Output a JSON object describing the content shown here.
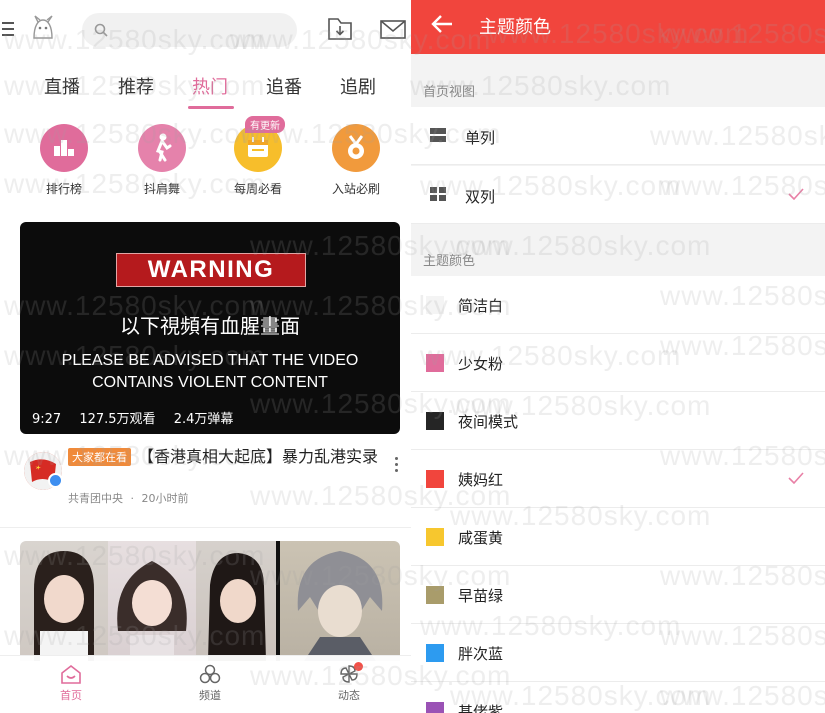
{
  "left": {
    "tabs": [
      "直播",
      "推荐",
      "热门",
      "追番",
      "追剧"
    ],
    "active_tab": "热门",
    "quick": [
      {
        "label": "排行榜",
        "color": "#e06c9b",
        "icon": "podium-icon"
      },
      {
        "label": "抖肩舞",
        "color": "#e582ab",
        "icon": "dancer-icon"
      },
      {
        "label": "每周必看",
        "color": "#f7be2b",
        "icon": "calendar-icon",
        "badge": "有更新"
      },
      {
        "label": "入站必刷",
        "color": "#f19a3c",
        "icon": "medal-icon"
      }
    ],
    "video": {
      "warning": "WARNING",
      "cn": "以下視頻有血腥畫面",
      "en1": "PLEASE BE ADVISED THAT THE VIDEO",
      "en2": "CONTAINS VIOLENT CONTENT",
      "duration": "9:27",
      "views": "127.5万观看",
      "danmaku": "2.4万弹幕"
    },
    "post": {
      "tag": "大家都在看",
      "title": "【香港真相大起底】暴力乱港实录",
      "author": "共青团中央",
      "time": "20小时前",
      "separator": "·"
    },
    "bottom_nav": [
      {
        "label": "首页",
        "icon": "home-icon"
      },
      {
        "label": "频道",
        "icon": "channels-icon"
      },
      {
        "label": "动态",
        "icon": "dynamics-icon"
      }
    ]
  },
  "right": {
    "title": "主题颜色",
    "view_section": "首页视图",
    "views": [
      {
        "label": "单列",
        "checked": false
      },
      {
        "label": "双列",
        "checked": true
      }
    ],
    "color_section": "主题颜色",
    "colors": [
      {
        "label": "简洁白",
        "color": "#f4f4f4",
        "checked": false
      },
      {
        "label": "少女粉",
        "color": "#e06c9b",
        "checked": false
      },
      {
        "label": "夜间模式",
        "color": "#252525",
        "checked": false
      },
      {
        "label": "姨妈红",
        "color": "#f1453d",
        "checked": true
      },
      {
        "label": "咸蛋黄",
        "color": "#f7c72e",
        "checked": false
      },
      {
        "label": "早苗绿",
        "color": "#a99c6b",
        "checked": false
      },
      {
        "label": "胖次蓝",
        "color": "#2d9bf0",
        "checked": false
      },
      {
        "label": "基佬紫",
        "color": "#9a52b5",
        "checked": false
      }
    ],
    "accent": "#f1453d",
    "check_color": "#e880a6"
  },
  "watermark": "www.12580sky.com"
}
